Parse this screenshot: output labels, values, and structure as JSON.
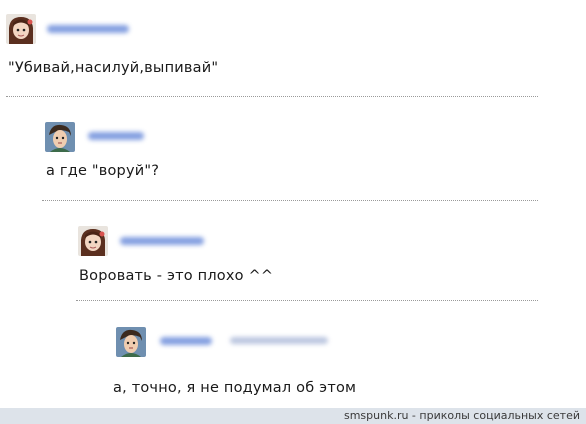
{
  "comments": [
    {
      "text": "\"Убивай,насилуй,выпивай\"",
      "avatar_icon": "girl-avatar-icon"
    },
    {
      "text": "а где \"воруй\"?",
      "avatar_icon": "boy-avatar-icon"
    },
    {
      "text": "Воровать - это плохо ^^",
      "avatar_icon": "girl-avatar-icon"
    },
    {
      "text": "а, точно, я не подумал об этом",
      "avatar_icon": "boy-avatar-icon"
    }
  ],
  "footer": {
    "text": "smspunk.ru - приколы социальных сетей"
  }
}
